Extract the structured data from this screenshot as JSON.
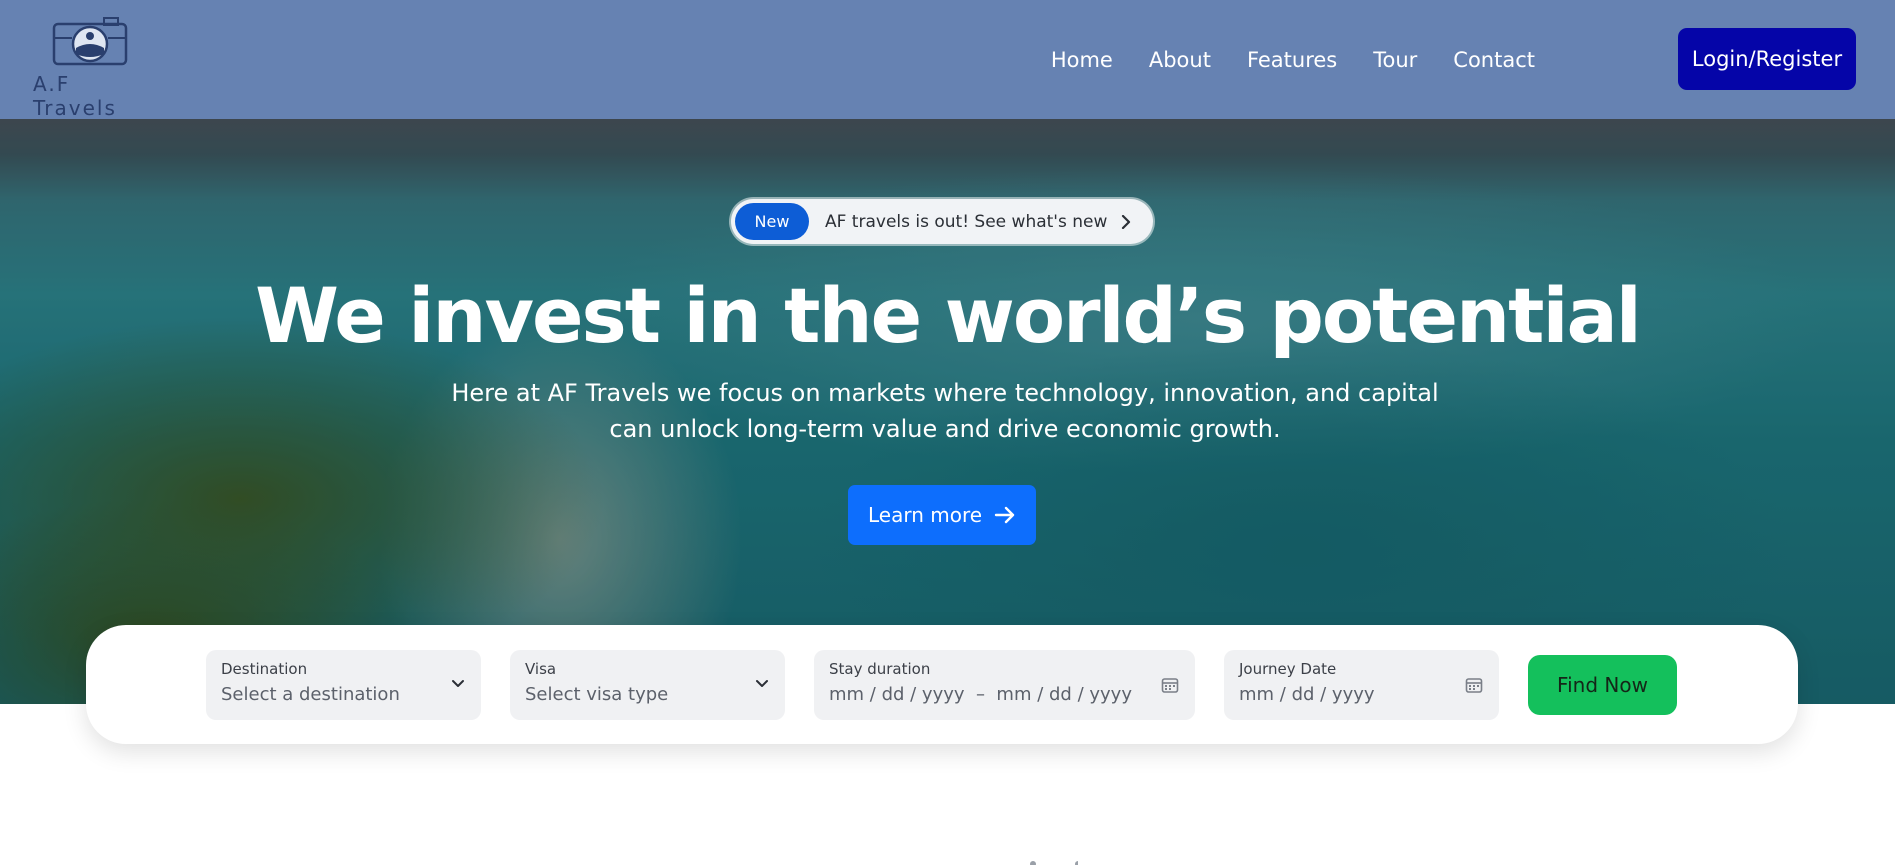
{
  "header": {
    "logo_text": "A.F Travels",
    "nav": [
      "Home",
      "About",
      "Features",
      "Tour",
      "Contact"
    ],
    "login_label": "Login/Register"
  },
  "hero": {
    "badge": "New",
    "announcement": "AF travels is out! See what's new",
    "title": "We invest in the world’s potential",
    "subtitle": "Here at AF Travels we focus on markets where technology, innovation, and capital can unlock long-term value and drive economic growth.",
    "cta_label": "Learn more"
  },
  "search": {
    "destination": {
      "label": "Destination",
      "placeholder": "Select a destination"
    },
    "visa": {
      "label": "Visa",
      "placeholder": "Select visa type"
    },
    "stay": {
      "label": "Stay duration",
      "placeholder": "mm / dd / yyyy  –  mm / dd / yyyy"
    },
    "journey": {
      "label": "Journey Date",
      "placeholder": "mm / dd / yyyy"
    },
    "find_label": "Find Now"
  },
  "colors": {
    "header_bg": "#6682b2",
    "login_bg": "#0505a8",
    "cta_bg": "#0d6efd",
    "badge_bg": "#0d5dd6",
    "find_bg": "#14c05c"
  },
  "icons": [
    "camera-logo-icon",
    "chevron-right-icon",
    "arrow-right-icon",
    "chevron-down-icon",
    "calendar-icon"
  ]
}
